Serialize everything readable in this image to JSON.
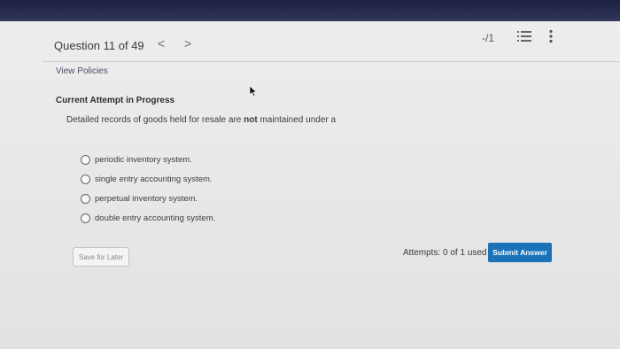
{
  "header": {
    "question_counter": "Question 11 of 49",
    "prev_label": "<",
    "next_label": ">",
    "score": "-/1"
  },
  "links": {
    "view_policies": "View Policies"
  },
  "attempt": {
    "heading": "Current Attempt in Progress"
  },
  "question": {
    "text_before": "Detailed records of goods held for resale are ",
    "text_bold": "not",
    "text_after": " maintained under a"
  },
  "options": [
    "periodic inventory system.",
    "single entry accounting system.",
    "perpetual inventory system.",
    "double entry accounting system."
  ],
  "footer": {
    "save_label": "Save for Later",
    "attempts_text": "Attempts: 0 of 1 used",
    "submit_label": "Submit Answer"
  },
  "colors": {
    "submit_button": "#1a73b8",
    "top_bezel": "#1c2142"
  },
  "icons": {
    "list": "list-icon",
    "more": "more-vertical-icon",
    "cursor": "mouse-pointer-icon"
  }
}
